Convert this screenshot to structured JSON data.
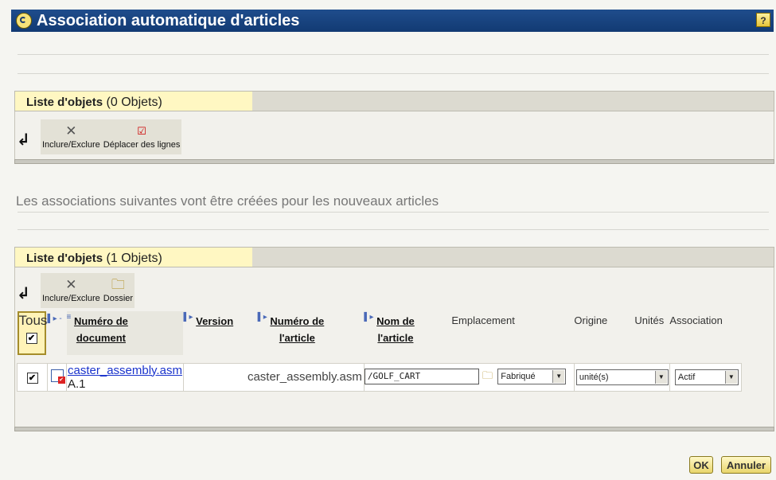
{
  "window": {
    "title": "Association automatique d'articles",
    "help_label": "?"
  },
  "list1": {
    "title": "Liste d'objets",
    "count": "(0 Objets)",
    "toolbar": {
      "include_exclude": "Inclure/Exclure",
      "move_rows": "Déplacer des lignes"
    }
  },
  "subtitle": "Les associations suivantes vont être créées pour les nouveaux articles",
  "list2": {
    "title": "Liste d'objets",
    "count": "(1 Objets)",
    "toolbar": {
      "include_exclude": "Inclure/Exclure",
      "folder": "Dossier"
    },
    "select_all": "Tous",
    "columns": {
      "doc_number_l1": "Numéro de",
      "doc_number_l2": "document",
      "version": "Version",
      "article_number_l1": "Numéro de",
      "article_number_l2": "l'article",
      "article_name_l1": "Nom de",
      "article_name_l2": "l'article",
      "location": "Emplacement",
      "origin": "Origine",
      "units": "Unités",
      "association": "Association"
    },
    "rows": [
      {
        "checked": true,
        "document": "caster_assembly.asm",
        "version": "A.1",
        "article_number": "caster_assembly.asm",
        "article_name": "/GOLF_CART",
        "origin": "Fabriqué",
        "units": "unité(s)",
        "association": "Actif"
      }
    ]
  },
  "buttons": {
    "ok": "OK",
    "cancel": "Annuler"
  }
}
